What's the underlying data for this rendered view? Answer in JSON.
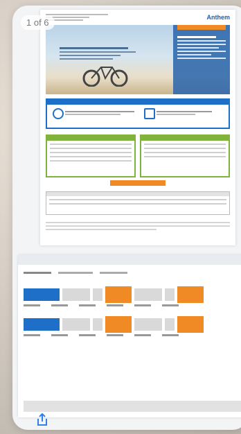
{
  "viewer": {
    "page_counter": "1 of 6",
    "share_icon": "share-icon"
  },
  "document": {
    "logo_text": "Anthem"
  }
}
